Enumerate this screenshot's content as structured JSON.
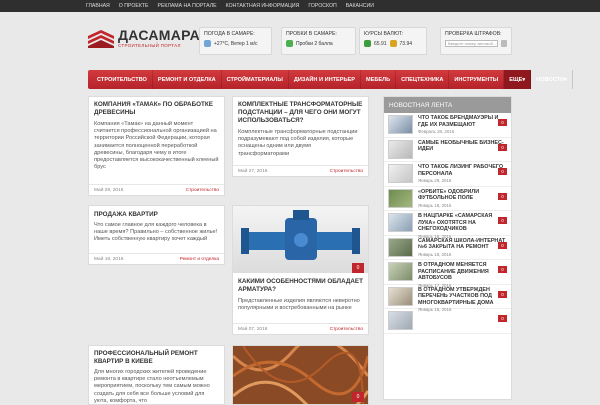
{
  "topbar": {
    "items": [
      "Главная",
      "О проекте",
      "Реклама на портале",
      "Контактная информация",
      "Гороскоп",
      "Вакансии"
    ]
  },
  "logo": {
    "title": "ДАСАМАРА",
    "subtitle": "Строительный портал"
  },
  "widgets": {
    "weather": {
      "title": "Погода в Самаре:",
      "value": "+27°C, Ветер 1 м/с"
    },
    "traffic": {
      "title": "Пробки в Самаре:",
      "value": "Пробки 2 балла"
    },
    "currency": {
      "title": "Курсы валют:",
      "usd": "65.91",
      "eur": "73.94"
    },
    "fines": {
      "title": "Проверка штрафов:",
      "placeholder": "Введите номер автомоб..."
    }
  },
  "nav": {
    "items": [
      "Строительство",
      "Ремонт и отделка",
      "Стройматериалы",
      "Дизайн и интерьер",
      "Мебель",
      "Спецтехника",
      "Инструменты",
      "Еще▾",
      "Новости▾"
    ]
  },
  "cards": [
    {
      "title": "Компания «Тамак» по обработке древесины",
      "text": "Компания «Тамак» на данный момент считается профессиональной организацией на территории Российской Федерации, которая занимается полноценной переработкой древесины, благодаря чему в итоге предоставляется высококачественный клееный брус",
      "date": "Май 29, 2016",
      "category": "Строительство"
    },
    {
      "title": "Комплектные трансформаторные подстанции – для чего они могут использоваться?",
      "text": "Комплектные трансформаторные подстанции подразумевают под собой изделия, которые оснащены одним или двумя трансформаторами",
      "date": "Май 27, 2016",
      "category": "Строительство"
    },
    {
      "title": "Продажа квартир",
      "text": "Что самое главное для каждого человека в наше время? Правильно – собственное жилье! Иметь собственную квартиру хочет каждый",
      "date": "Май 19, 2016",
      "category": "Ремонт и отделка"
    },
    {
      "title": "Какими особенностями обладает арматура?",
      "text": "Представленные изделия являются неверотно популярными и востребованными на рынке",
      "date": "Май 07, 2016",
      "category": "Строительство",
      "count": "0"
    },
    {
      "title": "Профессиональный ремонт квартир в Киеве",
      "text": "Для многих городских жителей проведение ремонта в квартире стало неотъемлемым мероприятием, поскольку тем самым можно создать для себя все больше условий для уюта, комфорта, что"
    },
    {
      "count": "0"
    }
  ],
  "feed": {
    "title": "Новостная лента",
    "items": [
      {
        "title": "Что такое брендмауэры и где их размещают",
        "date": "Февраль 28, 2016",
        "count": "0"
      },
      {
        "title": "Самые необычные бизнес-идеи",
        "date": "",
        "count": "0"
      },
      {
        "title": "Что такое лизинг рабочего персонала",
        "date": "Январь 29, 2016",
        "count": "0"
      },
      {
        "title": "«Орбите» одобрили футбольное поле",
        "date": "Январь 18, 2016",
        "count": "0"
      },
      {
        "title": "В нацпарке «Самарская Лука» охотятся на снегоходчиков",
        "date": "Январь 18, 2016",
        "count": "0"
      },
      {
        "title": "Самарская школа-интернат №6 закрыта на ремонт",
        "date": "Январь 18, 2016",
        "count": "0"
      },
      {
        "title": "В Отрадном меняется расписание движения автобусов",
        "date": "Январь 17, 2016",
        "count": "0"
      },
      {
        "title": "В Отрадном утвержден перечень участков под многоквартирные дома",
        "date": "Январь 15, 2016",
        "count": "0"
      },
      {
        "title": "",
        "date": "",
        "count": "0"
      }
    ]
  }
}
